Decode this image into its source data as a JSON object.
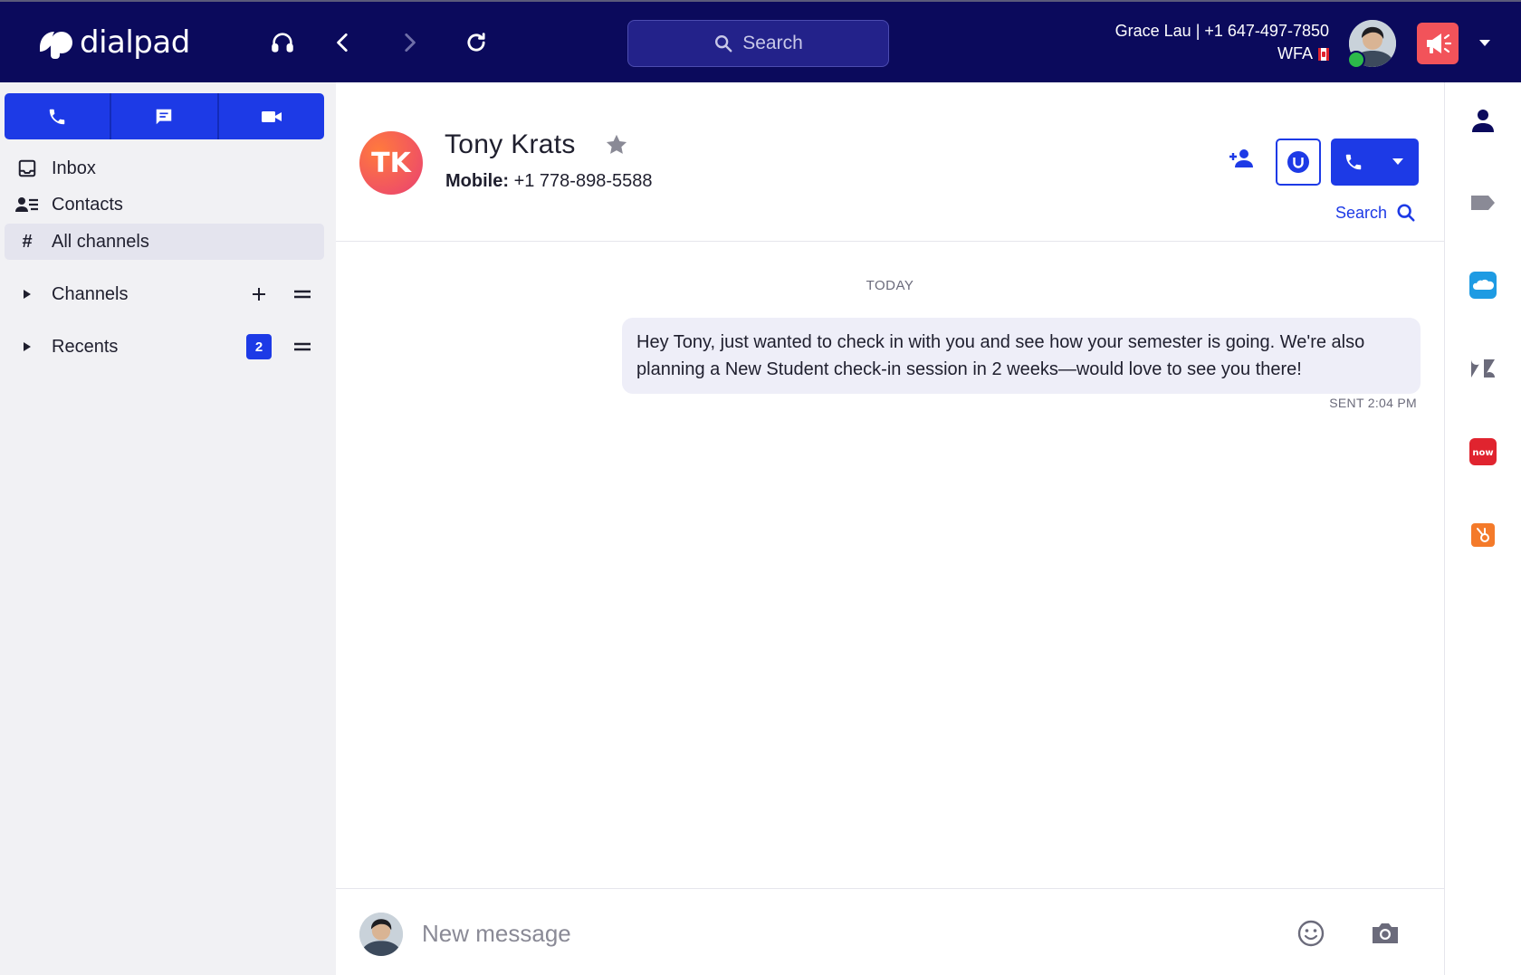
{
  "app": {
    "logo_text": "dialpad"
  },
  "topbar": {
    "search_placeholder": "Search",
    "user_line": "Grace Lau | +1 647-497-7850",
    "user_status": "WFA",
    "icons": [
      "headset-icon",
      "back-icon",
      "forward-icon",
      "refresh-icon",
      "announcement-icon",
      "caret-down-icon"
    ]
  },
  "sidebar": {
    "mode_tabs": [
      "phone-icon",
      "message-icon",
      "video-icon"
    ],
    "nav": [
      {
        "label": "Inbox",
        "icon": "inbox-icon"
      },
      {
        "label": "Contacts",
        "icon": "contacts-icon"
      },
      {
        "label": "All channels",
        "icon": "#"
      }
    ],
    "sections": [
      {
        "label": "Channels"
      },
      {
        "label": "Recents",
        "badge": "2"
      }
    ]
  },
  "contact": {
    "initials": "TK",
    "name": "Tony Krats",
    "phone_label": "Mobile:",
    "phone": "+1 778-898-5588",
    "search_label": "Search"
  },
  "conversation": {
    "day_label": "TODAY",
    "messages": [
      {
        "text": "Hey Tony, just wanted to check in with you and see how your semester is going. We're also planning a New Student check-in session in 2 weeks—would love to see you there!",
        "status": "SENT 2:04 PM"
      }
    ]
  },
  "composer": {
    "placeholder": "New message"
  },
  "rail": {
    "items": [
      "contact-info-icon",
      "tag-icon",
      "salesforce-icon",
      "zendesk-icon",
      "servicenow-icon",
      "hubspot-icon"
    ]
  },
  "colors": {
    "topbar": "#0b0a5c",
    "accent": "#1d3ae6",
    "announce": "#f2535a",
    "presence": "#2cba4a"
  }
}
